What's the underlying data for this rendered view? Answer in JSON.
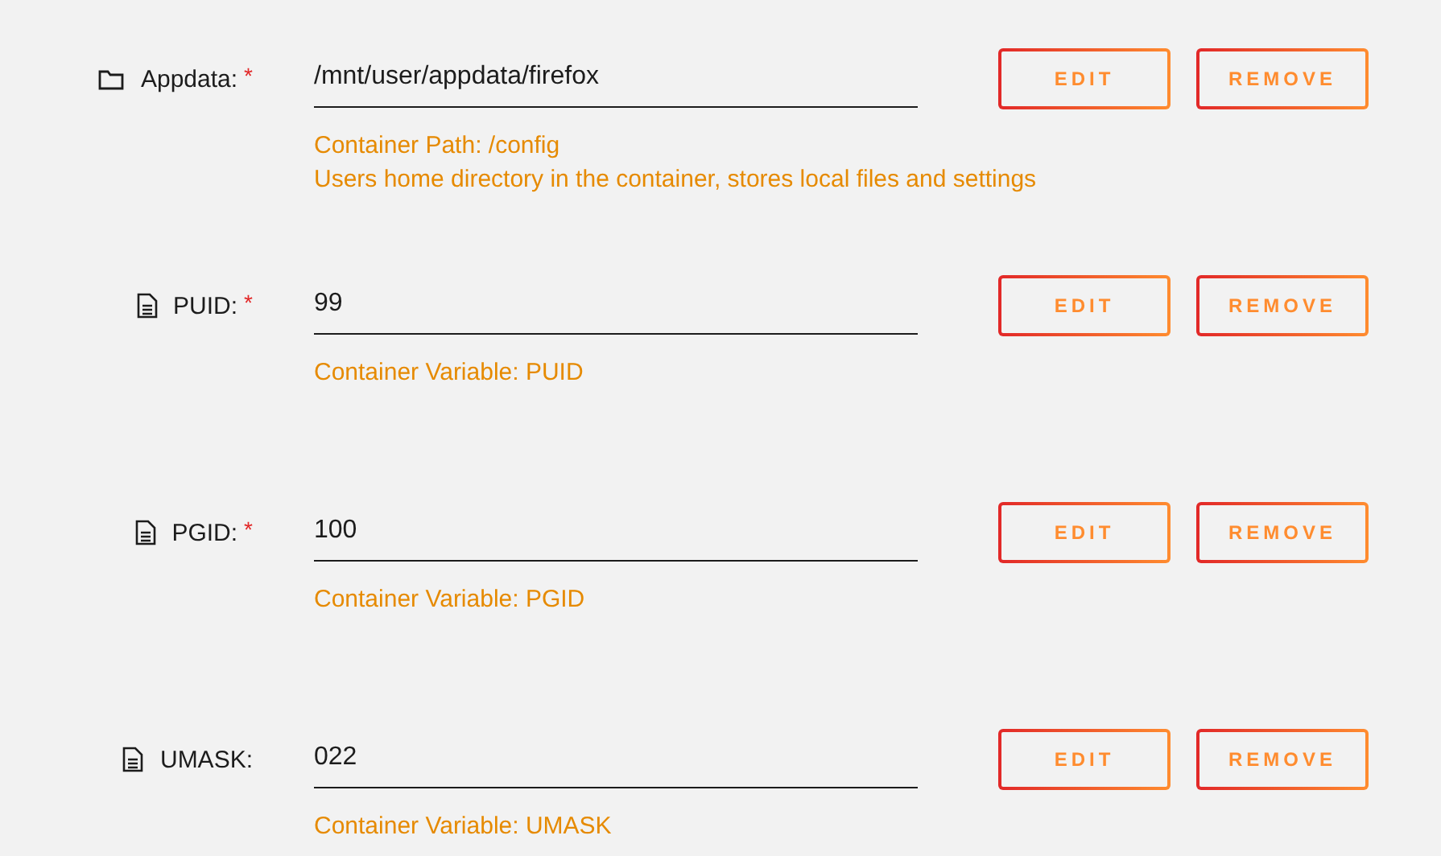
{
  "settings": [
    {
      "kind": "path",
      "label": "Appdata:",
      "required_mark": "*",
      "value": "/mnt/user/appdata/firefox",
      "descriptions": [
        "Container Path: /config",
        "Users home directory in the container, stores local files and settings"
      ],
      "buttons": [
        "EDIT",
        "REMOVE"
      ]
    },
    {
      "kind": "variable",
      "label": "PUID:",
      "required_mark": "*",
      "value": "99",
      "descriptions": [
        "Container Variable: PUID"
      ],
      "buttons": [
        "EDIT",
        "REMOVE"
      ]
    },
    {
      "kind": "variable",
      "label": "PGID:",
      "required_mark": "*",
      "value": "100",
      "descriptions": [
        "Container Variable: PGID"
      ],
      "buttons": [
        "EDIT",
        "REMOVE"
      ]
    },
    {
      "kind": "variable",
      "label": "UMASK:",
      "value": "022",
      "descriptions": [
        "Container Variable: UMASK"
      ],
      "buttons": [
        "EDIT",
        "REMOVE"
      ]
    }
  ]
}
